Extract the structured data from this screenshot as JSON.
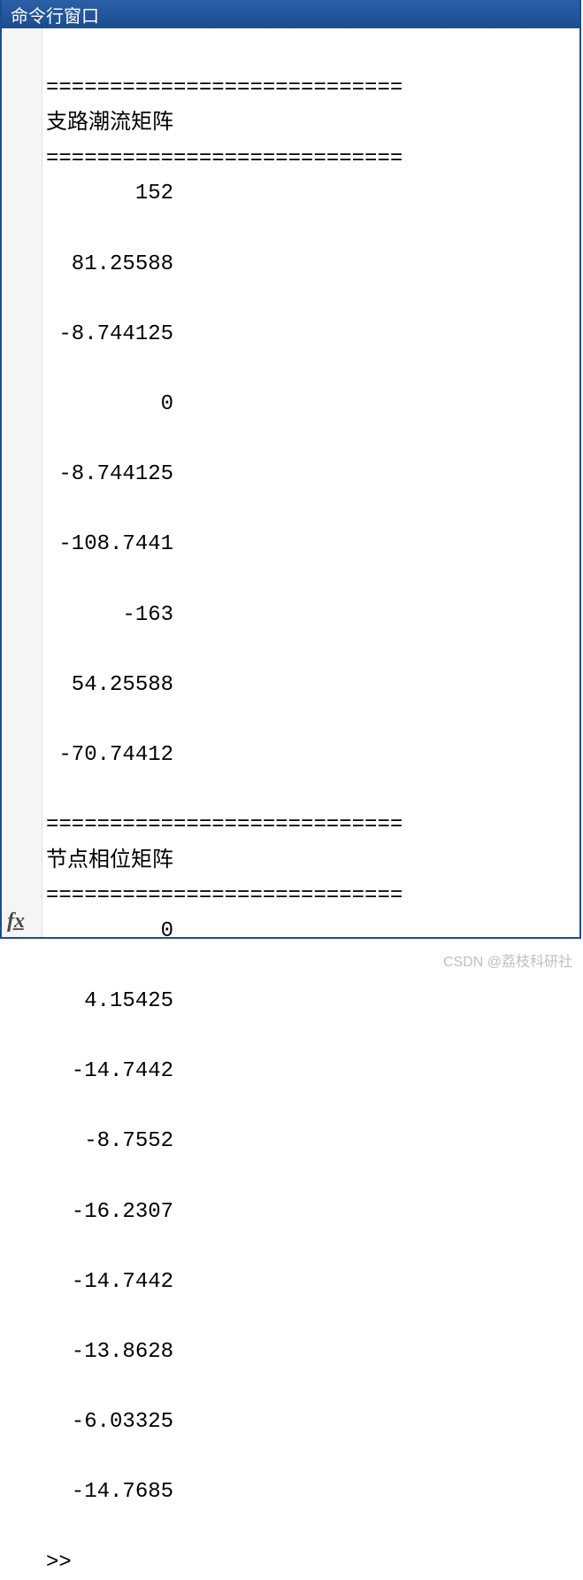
{
  "titlebar": {
    "title": "命令行窗口"
  },
  "output": {
    "divider": "============================",
    "section1_title": "支路潮流矩阵",
    "section1_values": [
      "       152",
      "  81.25588",
      " -8.744125",
      "         0",
      " -8.744125",
      " -108.7441",
      "      -163",
      "  54.25588",
      " -70.74412"
    ],
    "section2_title": "节点相位矩阵",
    "section2_values": [
      "         0",
      "   4.15425",
      "  -14.7442",
      "   -8.7552",
      "  -16.2307",
      "  -14.7442",
      "  -13.8628",
      "  -6.03325",
      "  -14.7685"
    ],
    "prompt": ">>"
  },
  "icons": {
    "fx": "fx"
  },
  "watermark": "CSDN @荔枝科研社"
}
